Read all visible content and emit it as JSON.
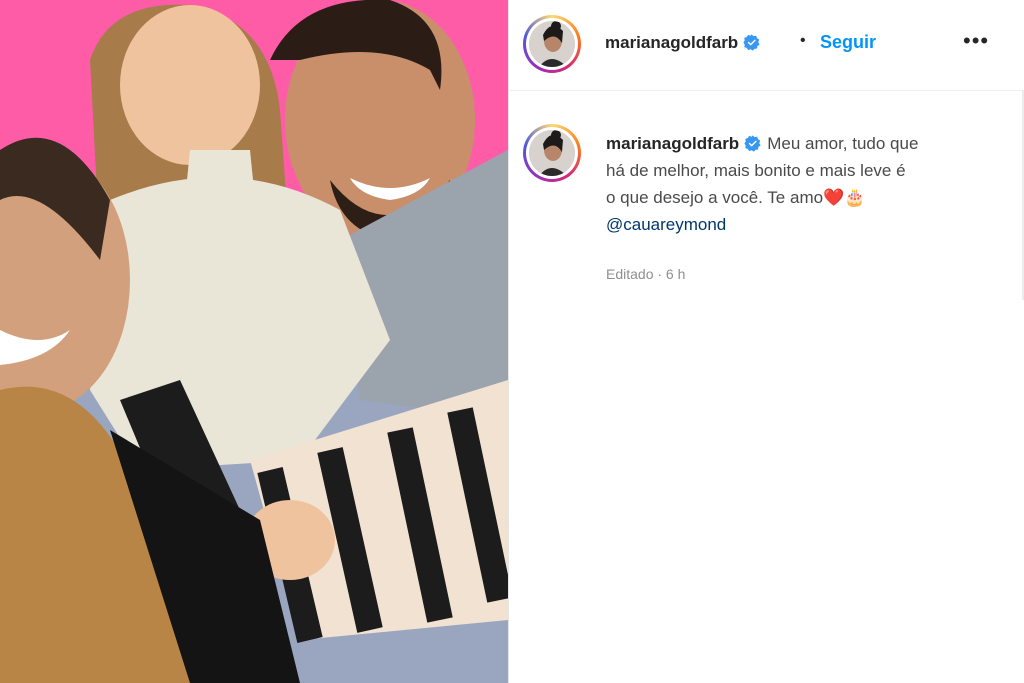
{
  "post": {
    "photo_alt": "photo",
    "username": "marianagoldfarb",
    "separator": "•",
    "follow_label": "Seguir",
    "more_label": "•••",
    "caption": {
      "username": "marianagoldfarb",
      "text_line1": "Meu amor, tudo que",
      "text_line2": "há de melhor, mais bonito e mais leve é",
      "text_line3": "o que desejo a você. Te amo",
      "emoji_heart": "❤️",
      "emoji_cake": "🎂",
      "mention": "@cauareymond"
    },
    "timestamp": "Editado · 6 h"
  },
  "colors": {
    "accent": "#0095f6",
    "verified": "#3897f0",
    "mention": "#00376b",
    "photo_bg": "#ff5ca8"
  },
  "icons": [
    "verified-badge-icon",
    "more-options-icon"
  ]
}
